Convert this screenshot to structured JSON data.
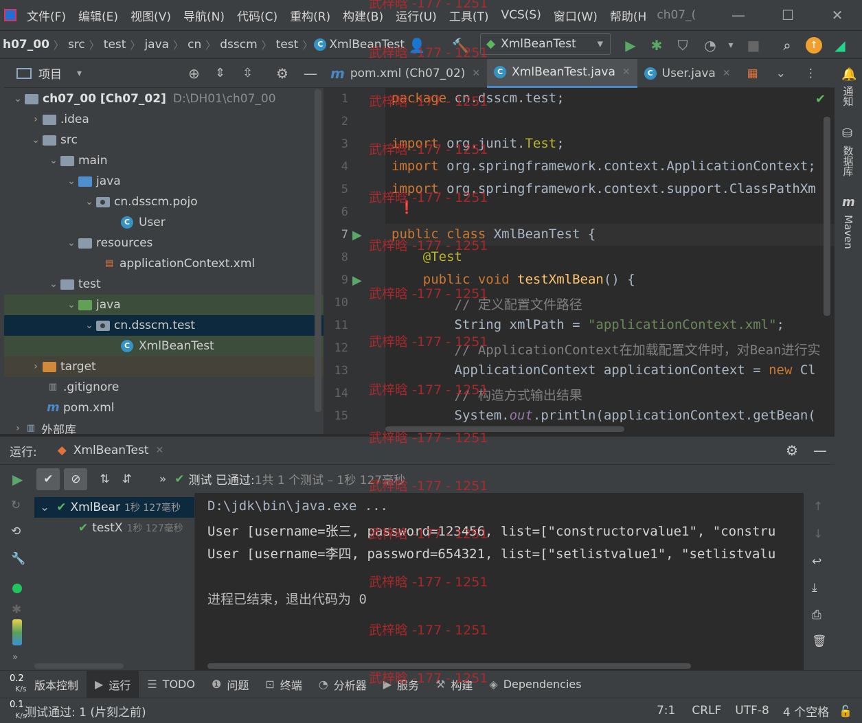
{
  "menubar": {
    "items": [
      "文件(F)",
      "编辑(E)",
      "视图(V)",
      "导航(N)",
      "代码(C)",
      "重构(R)",
      "构建(B)",
      "运行(U)",
      "工具(T)",
      "VCS(S)",
      "窗口(W)",
      "帮助(H"
    ],
    "project_title": "ch07_("
  },
  "breadcrumb": [
    "h07_00",
    "src",
    "test",
    "java",
    "cn",
    "dsscm",
    "test",
    "XmlBeanTest"
  ],
  "run_config": "XmlBeanTest",
  "project_panel": {
    "title": "项目",
    "rows": [
      {
        "label": "ch07_00 [Ch07_02]",
        "path": "D:\\DH01\\ch07_00"
      },
      {
        "label": ".idea"
      },
      {
        "label": "src"
      },
      {
        "label": "main"
      },
      {
        "label": "java"
      },
      {
        "label": "cn.dsscm.pojo"
      },
      {
        "label": "User"
      },
      {
        "label": "resources"
      },
      {
        "label": "applicationContext.xml"
      },
      {
        "label": "test"
      },
      {
        "label": "java"
      },
      {
        "label": "cn.dsscm.test"
      },
      {
        "label": "XmlBeanTest"
      },
      {
        "label": "target"
      },
      {
        "label": ".gitignore"
      },
      {
        "label": "pom.xml"
      },
      {
        "label": "外部库"
      }
    ]
  },
  "editor": {
    "tabs": [
      "pom.xml (Ch07_02)",
      "XmlBeanTest.java",
      "User.java"
    ],
    "line_numbers": [
      "1",
      "2",
      "3",
      "4",
      "5",
      "6",
      "7",
      "8",
      "9",
      "10",
      "11",
      "12",
      "13",
      "14",
      "15"
    ],
    "lines": {
      "l1a": "package",
      "l1b": " cn.dsscm.test;",
      "l3a": "import",
      "l3b": " org.junit.",
      "l3c": "Test",
      ";": ";",
      "l4a": "import",
      "l4b": " org.springframework.context.ApplicationContext;",
      "l5a": "import",
      "l5b": " org.springframework.context.support.ClassPathXm",
      "l7a": "public class",
      "l7b": " XmlBeanTest {",
      "l8": "    @Test",
      "l9a": "    public void ",
      "l9b": "testXmlBean",
      "l9c": "() {",
      "l10": "        // 定义配置文件路径",
      "l11a": "        String xmlPath = ",
      "l11b": "\"applicationContext.xml\"",
      "l11c": ";",
      "l12": "        // ApplicationContext在加载配置文件时，对Bean进行实",
      "l13a": "        ApplicationContext applicationContext = ",
      "l13b": "new",
      "l13c": " Cl",
      "l14": "        // 构造方式输出结果",
      "l15a": "        System.",
      "l15b": "out",
      "l15c": ".println(applicationContext.getBean("
    }
  },
  "right_stripe": {
    "notifications": "通知",
    "database": "数据库",
    "maven": "Maven"
  },
  "run_panel": {
    "label": "运行:",
    "tab": "XmlBeanTest",
    "status_prefix": "测试 已通过:",
    "status_count": "1共 1 个测试 – 1秒 127毫秒",
    "tree": [
      {
        "label": "XmlBear",
        "time": "1秒 127毫秒"
      },
      {
        "label": "testX",
        "time": "1秒 127毫秒"
      }
    ],
    "console": [
      "D:\\jdk\\bin\\java.exe ...",
      "User [username=张三, password=123456, list=[\"constructorvalue1\", \"constru",
      "User [username=李四, password=654321, list=[\"setlistvalue1\", \"setlistvalu",
      "",
      "进程已结束，退出代码为 0"
    ]
  },
  "bottom_tabs": [
    "版本控制",
    "运行",
    "TODO",
    "问题",
    "终端",
    "分析器",
    "服务",
    "构建",
    "Dependencies"
  ],
  "speed": {
    "up": "0.2",
    "up_unit": "K/s",
    "down": "0.1",
    "down_unit": "K/s"
  },
  "statusbar": {
    "message": "测试通过: 1 (片刻之前)",
    "position": "7:1",
    "line_sep": "CRLF",
    "encoding": "UTF-8",
    "indent": "4 个空格"
  },
  "watermark": "武梓晗 -177 - 1251"
}
